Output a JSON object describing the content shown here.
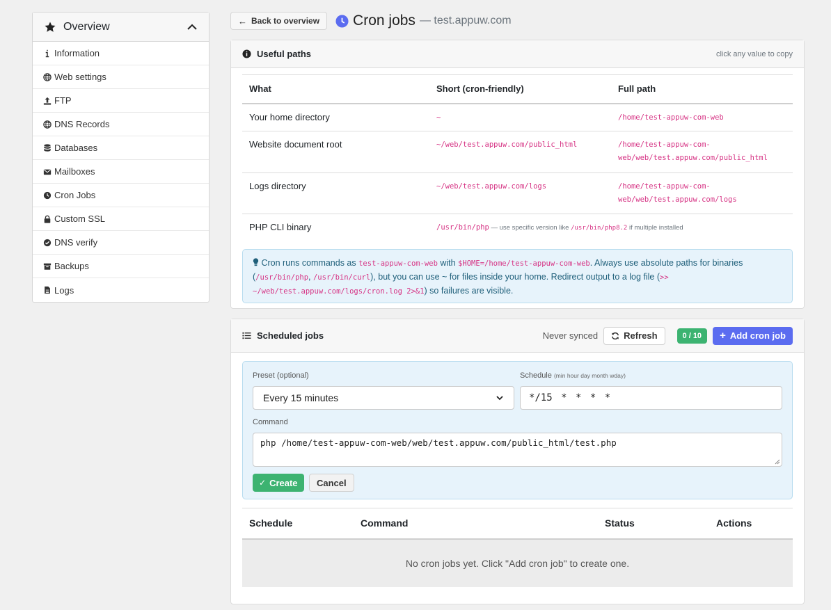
{
  "sidebar": {
    "header": "Overview",
    "items": [
      {
        "label": "Information",
        "icon": "info-icon"
      },
      {
        "label": "Web settings",
        "icon": "globe-icon"
      },
      {
        "label": "FTP",
        "icon": "upload-icon"
      },
      {
        "label": "DNS Records",
        "icon": "globe-icon"
      },
      {
        "label": "Databases",
        "icon": "database-icon"
      },
      {
        "label": "Mailboxes",
        "icon": "envelope-icon"
      },
      {
        "label": "Cron Jobs",
        "icon": "clock-icon"
      },
      {
        "label": "Custom SSL",
        "icon": "lock-icon"
      },
      {
        "label": "DNS verify",
        "icon": "check-circle-icon"
      },
      {
        "label": "Backups",
        "icon": "archive-icon"
      },
      {
        "label": "Logs",
        "icon": "file-icon"
      }
    ]
  },
  "header": {
    "back_label": "Back to overview",
    "title": "Cron jobs",
    "subtitle": "— test.appuw.com"
  },
  "paths": {
    "title": "Useful paths",
    "hint": "click any value to copy",
    "columns": [
      "What",
      "Short (cron-friendly)",
      "Full path"
    ],
    "rows": [
      {
        "what": "Your home directory",
        "short": "~",
        "full1": "/home/test-appuw-com-web",
        "full2": ""
      },
      {
        "what": "Website document root",
        "short": "~/web/test.appuw.com/public_html",
        "full1": "/home/test-appuw-com-",
        "full2": "web/web/test.appuw.com/public_html"
      },
      {
        "what": "Logs directory",
        "short": "~/web/test.appuw.com/logs",
        "full1": "/home/test-appuw-com-",
        "full2": "web/web/test.appuw.com/logs"
      },
      {
        "what": "PHP CLI binary",
        "short": "/usr/bin/php",
        "note_a": " — use specific version like ",
        "note_code": "/usr/bin/php8.2",
        "note_b": " if multiple installed"
      }
    ],
    "info": {
      "t1": " Cron runs commands as ",
      "c1": "test-appuw-com-web",
      "t2": " with ",
      "c2": "$HOME=/home/test-appuw-com-web",
      "t3": ". Always use absolute paths for binaries (",
      "c3": "/usr/bin/php",
      "t4": ", ",
      "c4": "/usr/bin/curl",
      "t5": "), but you can use ~ for files inside your home. Redirect output to a log file (",
      "c5a": ">>",
      "c5b": "~/web/test.appuw.com/logs/cron.log 2>&1",
      "t6": ") so failures are visible."
    }
  },
  "jobs": {
    "title": "Scheduled jobs",
    "sync_status": "Never synced",
    "refresh_label": "Refresh",
    "count": "0 / 10",
    "add_label": "Add cron job",
    "form": {
      "preset_label": "Preset (optional)",
      "preset_value": "Every 15 minutes",
      "schedule_label": "Schedule",
      "schedule_hint": "(min hour day month wday)",
      "schedule_value": "*/15 * * * *",
      "command_label": "Command",
      "command_value": "php /home/test-appuw-com-web/web/test.appuw.com/public_html/test.php",
      "create_label": "Create",
      "cancel_label": "Cancel"
    },
    "columns": [
      "Schedule",
      "Command",
      "Status",
      "Actions"
    ],
    "empty_text": "No cron jobs yet. Click \"Add cron job\" to create one."
  },
  "colors": {
    "accent": "#5b6cf0",
    "success": "#3cb371",
    "code": "#d63384",
    "info_bg": "#e7f3fb"
  }
}
